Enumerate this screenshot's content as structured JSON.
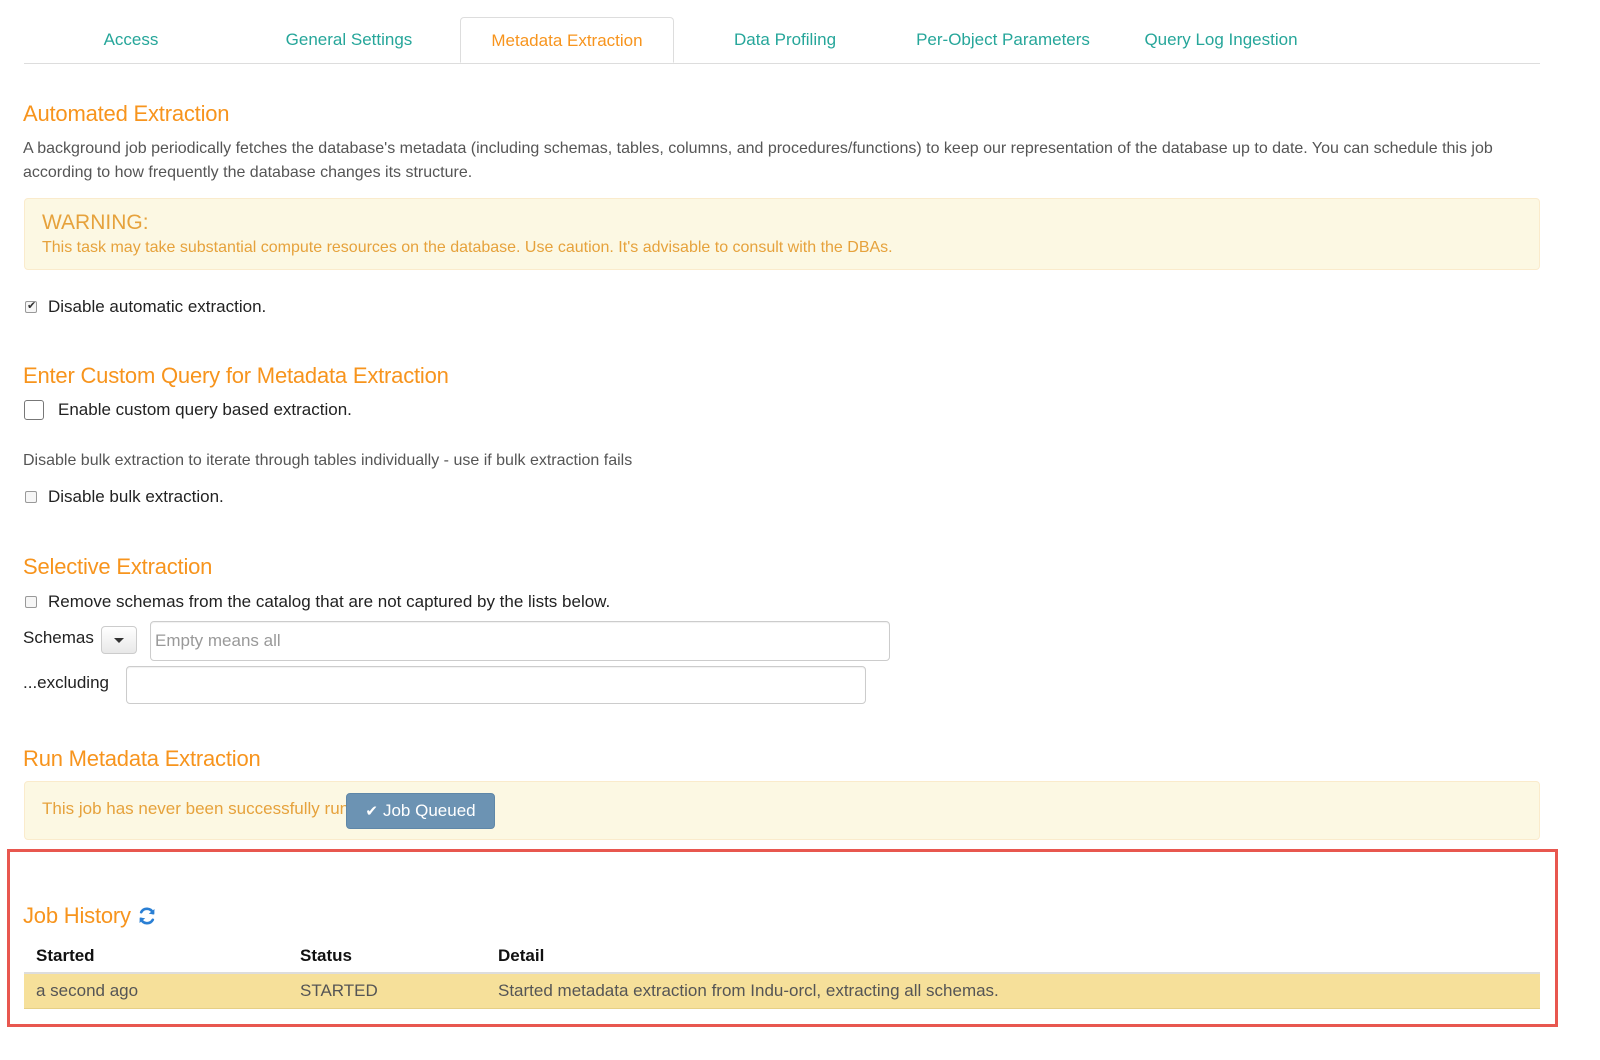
{
  "tabs": [
    {
      "label": "Access"
    },
    {
      "label": "General Settings"
    },
    {
      "label": "Metadata Extraction",
      "active": true
    },
    {
      "label": "Data Profiling"
    },
    {
      "label": "Per-Object Parameters"
    },
    {
      "label": "Query Log Ingestion"
    }
  ],
  "automated": {
    "title": "Automated Extraction",
    "description": "A background job periodically fetches the database's metadata (including schemas, tables, columns, and procedures/functions) to keep our representation of the database up to date. You can schedule this job according to how frequently the database changes its structure.",
    "warning_title": "WARNING:",
    "warning_text": "This task may take substantial compute resources on the database. Use caution. It's advisable to consult with the DBAs.",
    "disable_label": "Disable automatic extraction.",
    "disable_checked": true
  },
  "custom_query": {
    "title": "Enter Custom Query for Metadata Extraction",
    "enable_label": "Enable custom query based extraction.",
    "enable_checked": false,
    "bulk_hint": "Disable bulk extraction to iterate through tables individually - use if bulk extraction fails",
    "bulk_label": "Disable bulk extraction.",
    "bulk_checked": false
  },
  "selective": {
    "title": "Selective Extraction",
    "remove_label": "Remove schemas from the catalog that are not captured by the lists below.",
    "remove_checked": false,
    "schemas_label": "Schemas",
    "schemas_placeholder": "Empty means all",
    "excluding_label": "...excluding",
    "excluding_value": ""
  },
  "run": {
    "title": "Run Metadata Extraction",
    "status_text": "This job has never been successfully run.",
    "button_label": "Job Queued"
  },
  "history": {
    "title": "Job History",
    "columns": [
      "Started",
      "Status",
      "Detail"
    ],
    "rows": [
      {
        "started": "a second ago",
        "status": "STARTED",
        "detail": "Started metadata extraction from Indu-orcl, extracting all schemas."
      }
    ]
  },
  "colors": {
    "accent": "#f7941d",
    "tab_link": "#26a69a",
    "warning_bg": "#fcf8e3",
    "button_blue": "#6c93b3",
    "row_highlight": "#f6e09a",
    "annotation_red": "#e8574f",
    "refresh_blue": "#2a7fd4"
  }
}
